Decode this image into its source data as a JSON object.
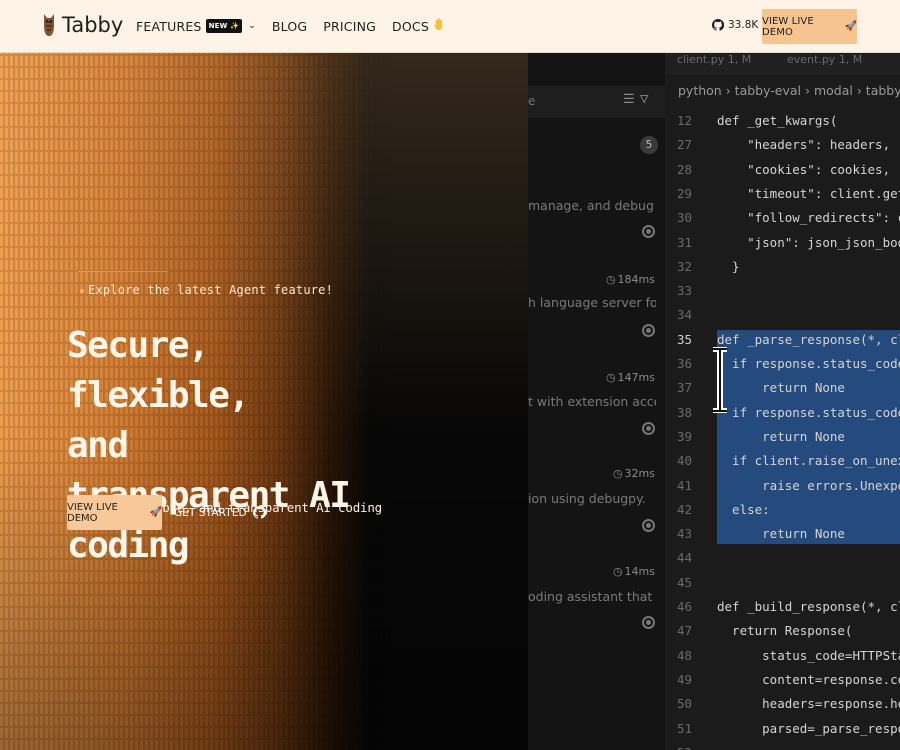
{
  "nav": {
    "brand": "Tabby",
    "links": [
      {
        "label": "FEATURES",
        "badge": "NEW ✨"
      },
      {
        "label": "BLOG"
      },
      {
        "label": "PRICING"
      },
      {
        "label": "DOCS"
      }
    ],
    "github_stars": "33.8K",
    "cta_label": "VIEW LIVE DEMO"
  },
  "hero": {
    "eyebrow": "Explore the latest Agent feature!",
    "title_lines": [
      "Secure, flexible,",
      "and transparent AI",
      "coding"
    ],
    "subtitle": "Secure, flexible, and transparent AI coding",
    "primary_button": "VIEW LIVE DEMO",
    "secondary_button": "GET STARTED"
  },
  "sidebar_panel": {
    "search_placeholder": "e",
    "count": "5",
    "rows": [
      {
        "text": "manage, and debug cont...",
        "stat": ""
      },
      {
        "text": "h language server for Py...",
        "stat": "184ms"
      },
      {
        "text": "t with extension access ...",
        "stat": "147ms"
      },
      {
        "text": "ion using debugpy.",
        "stat": "32ms"
      },
      {
        "text": "oding assistant that ca...",
        "stat": "14ms"
      }
    ]
  },
  "editor": {
    "tabs": [
      "client.py 1, M",
      "event.py 1, M"
    ],
    "breadcrumb": "python › tabby-eval › modal › tabby_python_",
    "lines": [
      {
        "n": "12",
        "text": "def _get_kwargs("
      },
      {
        "n": "27",
        "text": "    \"headers\": headers,"
      },
      {
        "n": "28",
        "text": "    \"cookies\": cookies,"
      },
      {
        "n": "29",
        "text": "    \"timeout\": client.get_ti"
      },
      {
        "n": "30",
        "text": "    \"follow_redirects\": clie"
      },
      {
        "n": "31",
        "text": "    \"json\": json_json_body,"
      },
      {
        "n": "32",
        "text": "  }"
      },
      {
        "n": "33",
        "text": ""
      },
      {
        "n": "34",
        "text": ""
      },
      {
        "n": "35",
        "text": "def _parse_response(*, client: C"
      },
      {
        "n": "36",
        "text": "  if response.status_code == HT"
      },
      {
        "n": "37",
        "text": "      return None"
      },
      {
        "n": "38",
        "text": "  if response.status_code == HT"
      },
      {
        "n": "39",
        "text": "      return None"
      },
      {
        "n": "40",
        "text": "  if client.raise_on_unexpecte"
      },
      {
        "n": "41",
        "text": "      raise errors.UnexpectedS"
      },
      {
        "n": "42",
        "text": "  else:"
      },
      {
        "n": "43",
        "text": "      return None"
      },
      {
        "n": "44",
        "text": ""
      },
      {
        "n": "45",
        "text": ""
      },
      {
        "n": "46",
        "text": "def _build_response(*, client: C"
      },
      {
        "n": "47",
        "text": "  return Response("
      },
      {
        "n": "48",
        "text": "      status_code=HTTPStatus(re"
      },
      {
        "n": "49",
        "text": "      content=response.content"
      },
      {
        "n": "50",
        "text": "      headers=response.headers"
      },
      {
        "n": "51",
        "text": "      parsed=_parse_response(c"
      },
      {
        "n": "52",
        "text": ""
      }
    ]
  },
  "colors": {
    "nav_bg": "#fdf4e7",
    "cta": "#f6c490",
    "hero_warm": "#d27c32",
    "selection": "#254a7d"
  }
}
